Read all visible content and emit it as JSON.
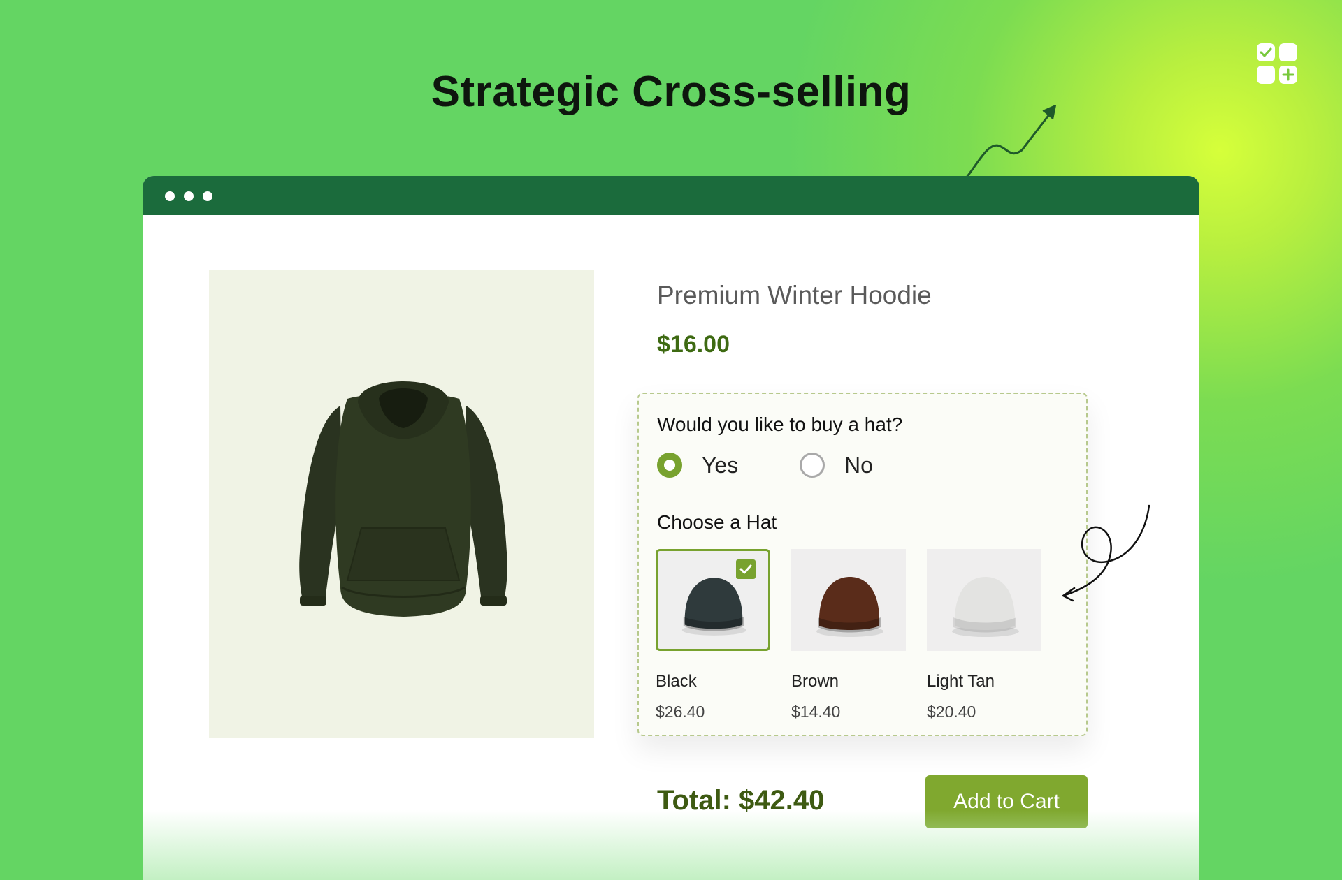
{
  "headline": "Strategic Cross-selling",
  "colors": {
    "background": "#64d563",
    "titlebar": "#1b6b3c",
    "accent": "#78a22f",
    "price": "#3e6a12",
    "button": "#80a82f"
  },
  "product": {
    "title": "Premium Winter Hoodie",
    "price": "$16.00",
    "image": "hoodie-image"
  },
  "upsell": {
    "question": "Would you like to buy a hat?",
    "options": [
      {
        "label": "Yes",
        "selected": true
      },
      {
        "label": "No",
        "selected": false
      }
    ],
    "choose_label": "Choose a Hat",
    "hats": [
      {
        "name": "Black",
        "price": "$26.40",
        "selected": true,
        "color": "#2f3a3c"
      },
      {
        "name": "Brown",
        "price": "$14.40",
        "selected": false,
        "color": "#5a2c1a"
      },
      {
        "name": "Light Tan",
        "price": "$20.40",
        "selected": false,
        "color": "#e3e3e1"
      }
    ]
  },
  "cart": {
    "total": "Total: $42.40",
    "button_label": "Add to Cart"
  }
}
